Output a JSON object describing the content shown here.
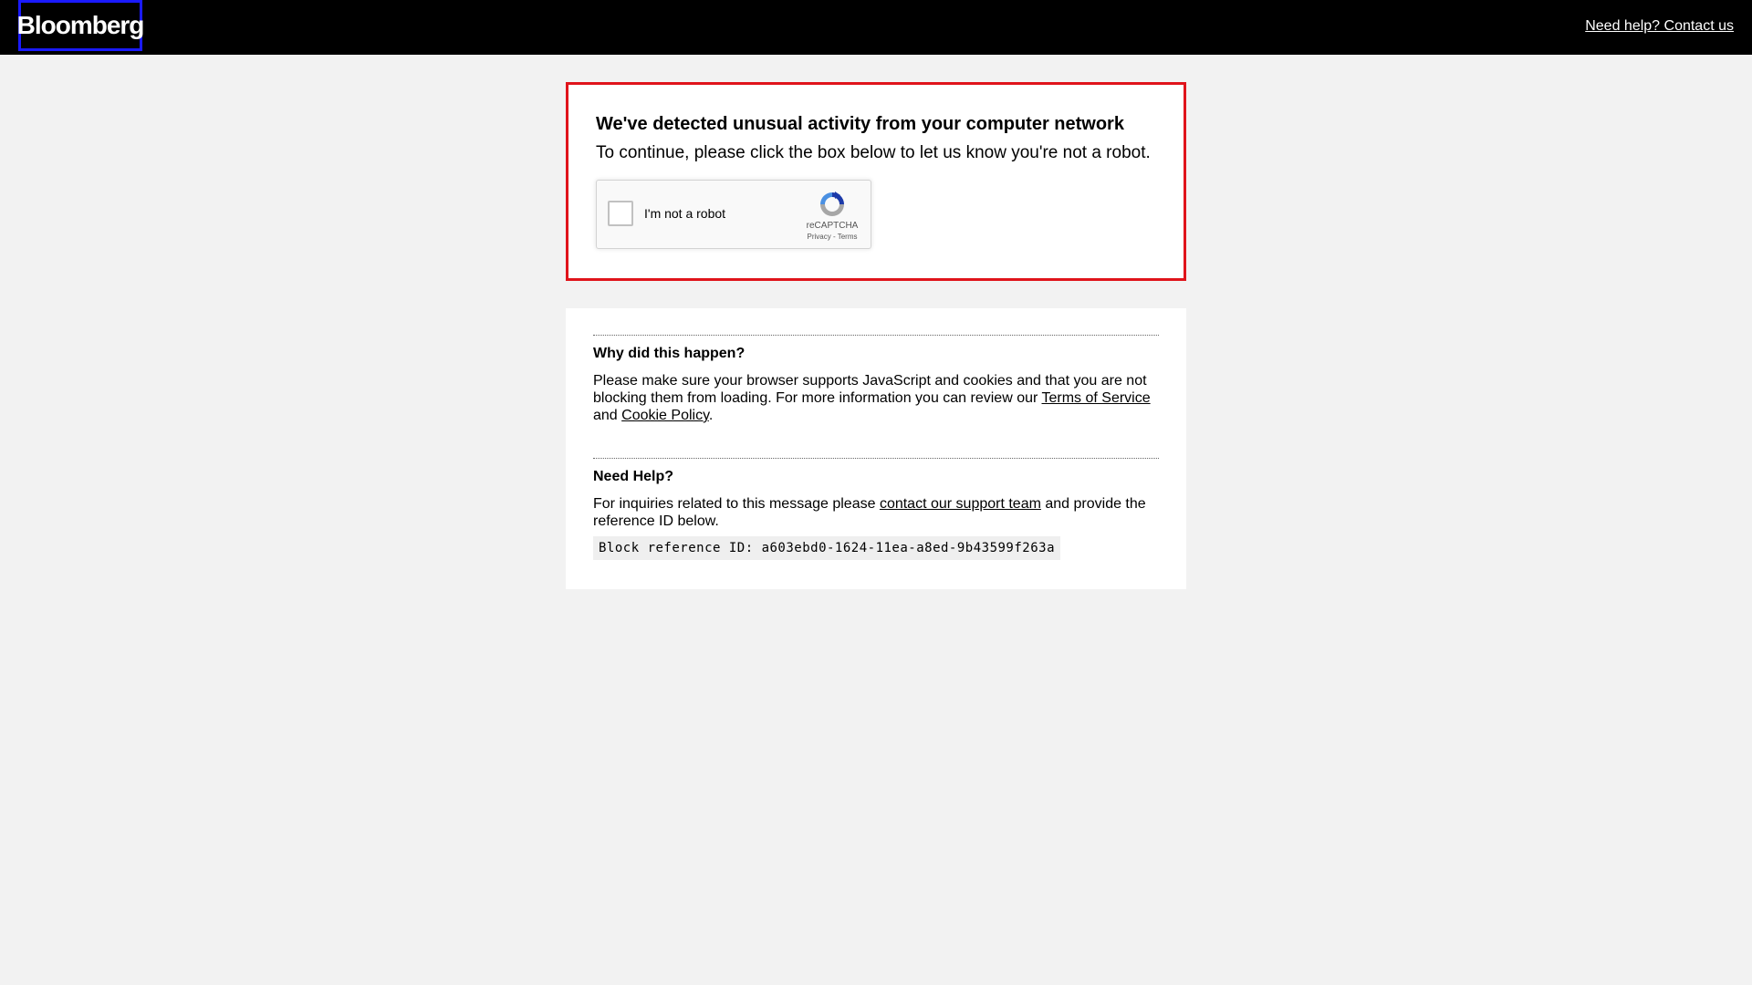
{
  "header": {
    "logo_text": "Bloomberg",
    "help_link": "Need help? Contact us"
  },
  "alert": {
    "title": "We've detected unusual activity from your computer network",
    "subtitle": "To continue, please click the box below to let us know you're not a robot."
  },
  "captcha": {
    "label": "I'm not a robot",
    "brand": "reCAPTCHA",
    "privacy": "Privacy",
    "separator": " - ",
    "terms": "Terms",
    "checked": false
  },
  "why": {
    "title": "Why did this happen?",
    "text_1": "Please make sure your browser supports JavaScript and cookies and that you are not blocking them from loading. For more information you can review our ",
    "terms_link": "Terms of Service",
    "text_2": " and ",
    "cookie_link": "Cookie Policy",
    "text_3": "."
  },
  "help": {
    "title": "Need Help?",
    "text_1": "For inquiries related to this message please ",
    "support_link": "contact our support team",
    "text_2": " and provide the reference ID below.",
    "reference_id": "Block reference ID: a603ebd0-1624-11ea-a8ed-9b43599f263a"
  },
  "colors": {
    "alert_border": "#e0141b",
    "logo_border": "#1a1aff",
    "header_bg": "#000000",
    "page_bg": "#f2f2f2"
  }
}
